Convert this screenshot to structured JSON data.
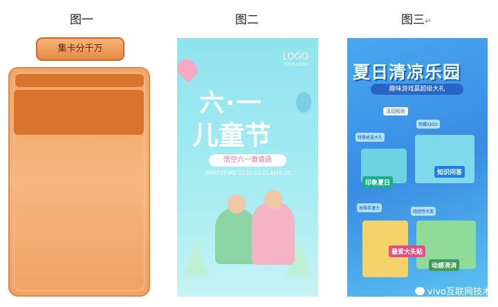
{
  "captions": [
    "图一",
    "图二",
    "图三"
  ],
  "caption3_mark": "↵",
  "panel1": {
    "title_badge": "集卡分千万"
  },
  "panel2": {
    "logo": "LOGO",
    "logo_sub": "YOUR LOGO",
    "title_line1": "六·一",
    "title_line2": "儿童节",
    "invite": "悟空六一邀请函",
    "subline": "PARTYTIME 2020.05.01AM9:00"
  },
  "panel3": {
    "title": "夏日清凉乐园",
    "subtitle": "趣味游戏赢超级大礼",
    "rules": "活动规则",
    "cards": [
      "特惠机送大礼",
      "荣耀iQOO",
      "组团夺大奖",
      "抢购手速大"
    ],
    "tags": [
      "知识问答",
      "印象夏日",
      "最爱大头贴",
      "动感消消"
    ],
    "watermark": "vivo互联网技术"
  }
}
